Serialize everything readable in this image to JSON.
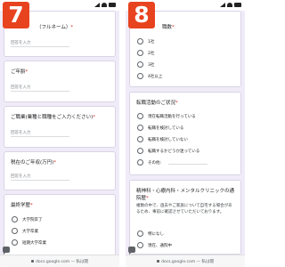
{
  "left": {
    "badge": "7",
    "questions": [
      {
        "title": "（フルネーム）",
        "required": "*",
        "placeholder": "回答を入力"
      },
      {
        "title": "ご年齢",
        "required": "*",
        "placeholder": "回答を入力"
      },
      {
        "title": "ご職業(業種と職種をご入力ください)",
        "required": "*",
        "placeholder": "回答を入力"
      },
      {
        "title": "税在のご年収(万円)",
        "required": "*",
        "placeholder": "回答を入力"
      }
    ],
    "education": {
      "title": "最終学歴",
      "required": "*",
      "options": [
        "大学院卒了",
        "大学卒業",
        "短期大学卒業"
      ]
    },
    "url": "docs.google.com — 私は閲"
  },
  "right": {
    "badge": "8",
    "q1": {
      "title": "職数",
      "required": "*",
      "options": [
        "1社",
        "2社",
        "3社",
        "4社以上"
      ]
    },
    "q2": {
      "title": "転職活動のご状況",
      "required": "*",
      "options": [
        "現在転職活動を行っている",
        "転職を検討している",
        "転職を検討していない",
        "転職するかどうか迷っている",
        "その他:"
      ]
    },
    "q3": {
      "title": "精神科・心療内科・メンタルクリニックの通院歴",
      "required": "*",
      "description": "複数の中で、過去やご家族について自宅する場合があるため、事前に確認させていただいております。",
      "options": [
        "特になし",
        "現在、通院中"
      ]
    },
    "url": "docs.google.com — 私は閲"
  }
}
